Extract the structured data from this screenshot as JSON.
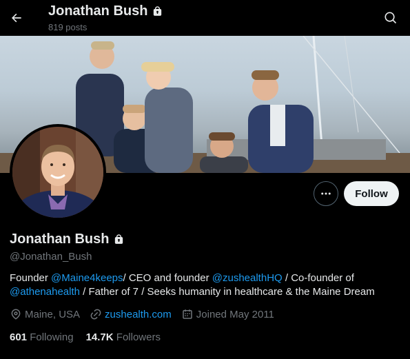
{
  "header": {
    "name": "Jonathan Bush",
    "posts": "819 posts"
  },
  "profile": {
    "name": "Jonathan Bush",
    "handle": "@Jonathan_Bush",
    "follow_label": "Follow",
    "bio": {
      "t1": "Founder ",
      "m1": "@Maine4keeps",
      "t2": "/ CEO and founder ",
      "m2": "@zushealthHQ",
      "t3": " / Co-founder of ",
      "m3": "@athenahealth",
      "t4": " / Father of 7 / Seeks humanity in healthcare & the Maine Dream"
    },
    "location": "Maine, USA",
    "website": "zushealth.com",
    "joined": "Joined May 2011",
    "following_count": "601",
    "following_label": "Following",
    "followers_count": "14.7K",
    "followers_label": "Followers"
  },
  "colors": {
    "accent": "#1d9bf0",
    "muted": "#71767b",
    "background": "#000000"
  },
  "icons": [
    "back-arrow-icon",
    "lock-icon",
    "search-icon",
    "more-icon",
    "location-icon",
    "link-icon",
    "calendar-icon"
  ]
}
